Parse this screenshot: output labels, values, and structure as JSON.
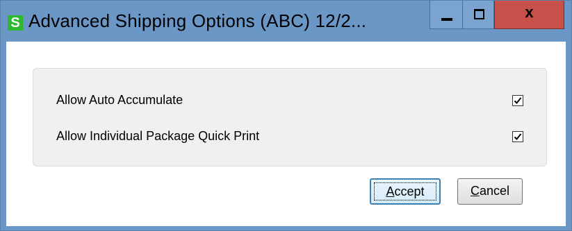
{
  "window": {
    "title": "Advanced Shipping Options (ABC) 12/2...",
    "app_icon_letter": "S",
    "controls": {
      "minimize": "minimize",
      "maximize": "maximize",
      "close": "x"
    }
  },
  "options": [
    {
      "label": "Allow Auto Accumulate",
      "checked": true
    },
    {
      "label": "Allow Individual Package Quick Print",
      "checked": true
    }
  ],
  "buttons": {
    "accept": {
      "mnemonic": "A",
      "rest": "ccept"
    },
    "cancel": {
      "mnemonic": "C",
      "rest": "ancel"
    }
  },
  "colors": {
    "titlebar": "#6b97c6",
    "close_button": "#c7504a",
    "app_icon": "#2eb82e",
    "group_background": "#f0f0f0"
  }
}
